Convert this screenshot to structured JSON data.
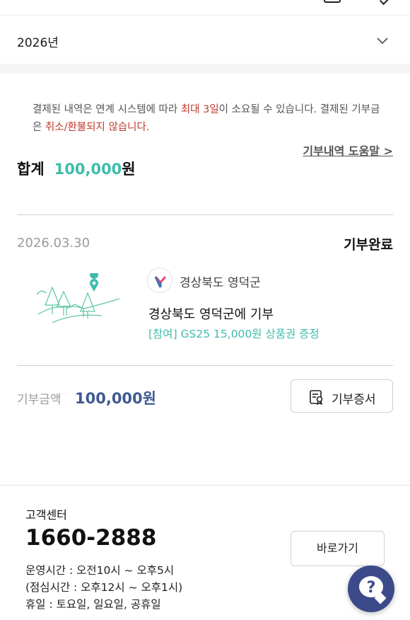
{
  "filter": {
    "year": "2026년"
  },
  "notice": {
    "part1": "결제된 내역은 연계 시스템에 따라 ",
    "highlight1": "최대 3일",
    "part2": "이 소요될 수 있습니다. 결제된 기부금은 ",
    "highlight2": "취소/환불되지 않습니다."
  },
  "help_link": "기부내역 도움말 >",
  "total": {
    "label": "합계",
    "amount": "100,000",
    "unit": "원"
  },
  "donation": {
    "date": "2026.03.30",
    "status": "기부완료",
    "org_name": "경상북도 영덕군",
    "title": "경상북도 영덕군에 기부",
    "reward": "[참여] GS25 15,000원 상품권 증정",
    "amount_label": "기부금액",
    "amount_value": "100,000원",
    "certificate_label": "기부증서"
  },
  "customer_center": {
    "title": "고객센터",
    "phone": "1660-2888",
    "hours_line1": "운영시간 : 오전10시 ~ 오후5시",
    "hours_line2": "(점심시간 : 오후12시 ~ 오후1시)",
    "hours_line3": "휴일 : 토요일, 일요일, 공휴일",
    "go_button": "바로가기"
  },
  "colors": {
    "accent_teal": "#3ebcab",
    "warning_red": "#c0392b",
    "amount_blue": "#3f5a92",
    "chat_fab": "#3d4a8a"
  },
  "icons": [
    "chevron-down-icon",
    "location-pin-icon",
    "certificate-icon",
    "chat-help-icon"
  ]
}
